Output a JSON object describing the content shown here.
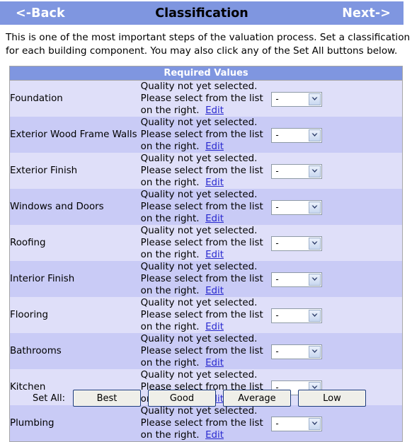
{
  "nav": {
    "back_label": "<-Back",
    "title": "Classification",
    "next_label": "Next->"
  },
  "intro": {
    "text": "This is one of the most important steps of the valuation process. Set a classification for each building component. You may also click any of the Set All buttons below."
  },
  "table": {
    "header": "Required Values",
    "message": "Quality not yet selected. Please select from the list on the right.",
    "edit_label": "Edit",
    "select_value": "-",
    "rows": [
      {
        "label": "Foundation"
      },
      {
        "label": "Exterior Wood Frame Walls"
      },
      {
        "label": "Exterior Finish"
      },
      {
        "label": "Windows and Doors"
      },
      {
        "label": "Roofing"
      },
      {
        "label": "Interior Finish"
      },
      {
        "label": "Flooring"
      },
      {
        "label": "Bathrooms"
      },
      {
        "label": "Kitchen"
      },
      {
        "label": "Plumbing"
      }
    ]
  },
  "set_all": {
    "label": "Set All:",
    "buttons": [
      {
        "label": "Best"
      },
      {
        "label": "Good"
      },
      {
        "label": "Average"
      },
      {
        "label": "Low"
      }
    ]
  },
  "colors": {
    "header_blue": "#7f96e0",
    "row_odd": "#c9cbf6",
    "row_even": "#dfdff9",
    "link_blue": "#2a2ad0",
    "button_face": "#efefe9",
    "button_border": "#1b3a7a"
  }
}
